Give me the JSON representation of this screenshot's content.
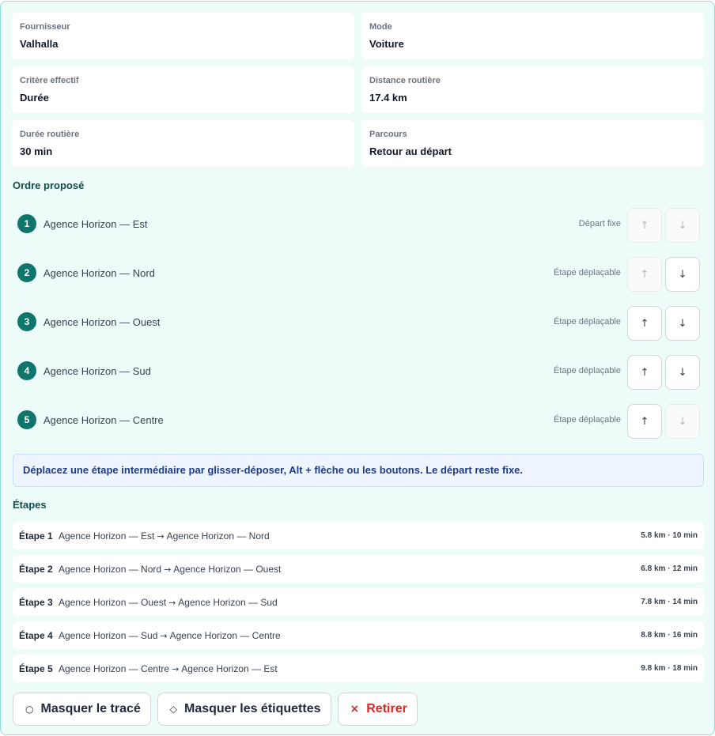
{
  "summary": [
    {
      "label": "Fournisseur",
      "value": "Valhalla"
    },
    {
      "label": "Mode",
      "value": "Voiture"
    },
    {
      "label": "Critère effectif",
      "value": "Durée"
    },
    {
      "label": "Distance routière",
      "value": "17.4 km"
    },
    {
      "label": "Durée routière",
      "value": "30 min"
    },
    {
      "label": "Parcours",
      "value": "Retour au départ"
    }
  ],
  "order": {
    "title": "Ordre proposé",
    "stops": [
      {
        "number": "1",
        "name": "Agence Horizon — Est",
        "role": "Départ fixe",
        "up_icon": "↑",
        "down_icon": "↓",
        "up_enabled": false,
        "down_enabled": false
      },
      {
        "number": "2",
        "name": "Agence Horizon — Nord",
        "role": "Étape déplaçable",
        "up_icon": "↑",
        "down_icon": "↓",
        "up_enabled": false,
        "down_enabled": true
      },
      {
        "number": "3",
        "name": "Agence Horizon — Ouest",
        "role": "Étape déplaçable",
        "up_icon": "↑",
        "down_icon": "↓",
        "up_enabled": true,
        "down_enabled": true
      },
      {
        "number": "4",
        "name": "Agence Horizon — Sud",
        "role": "Étape déplaçable",
        "up_icon": "↑",
        "down_icon": "↓",
        "up_enabled": true,
        "down_enabled": true
      },
      {
        "number": "5",
        "name": "Agence Horizon — Centre",
        "role": "Étape déplaçable",
        "up_icon": "↑",
        "down_icon": "↓",
        "up_enabled": true,
        "down_enabled": false
      }
    ]
  },
  "hint": "Déplacez une étape intermédiaire par glisser-déposer, Alt + flèche ou les boutons. Le départ reste fixe.",
  "legs": {
    "title": "Étapes",
    "arrow": "→",
    "items": [
      {
        "id": "Étape 1",
        "from": "Agence Horizon — Est",
        "to": "Agence Horizon — Nord",
        "stat": "5.8 km · 10 min"
      },
      {
        "id": "Étape 2",
        "from": "Agence Horizon — Nord",
        "to": "Agence Horizon — Ouest",
        "stat": "6.8 km · 12 min"
      },
      {
        "id": "Étape 3",
        "from": "Agence Horizon — Ouest",
        "to": "Agence Horizon — Sud",
        "stat": "7.8 km · 14 min"
      },
      {
        "id": "Étape 4",
        "from": "Agence Horizon — Sud",
        "to": "Agence Horizon — Centre",
        "stat": "8.8 km · 16 min"
      },
      {
        "id": "Étape 5",
        "from": "Agence Horizon — Centre",
        "to": "Agence Horizon — Est",
        "stat": "9.8 km · 18 min"
      }
    ]
  },
  "actions": {
    "hide_route_icon": "○",
    "hide_route_label": "Masquer le tracé",
    "hide_labels_icon": "◇",
    "hide_labels_label": "Masquer les étiquettes",
    "remove_icon": "×",
    "remove_label": "Retirer"
  },
  "colors": {
    "accent": "#0f766e",
    "panel_bg": "#eefcf9",
    "danger": "#dc2626",
    "hint_text": "#1e3a8a"
  }
}
